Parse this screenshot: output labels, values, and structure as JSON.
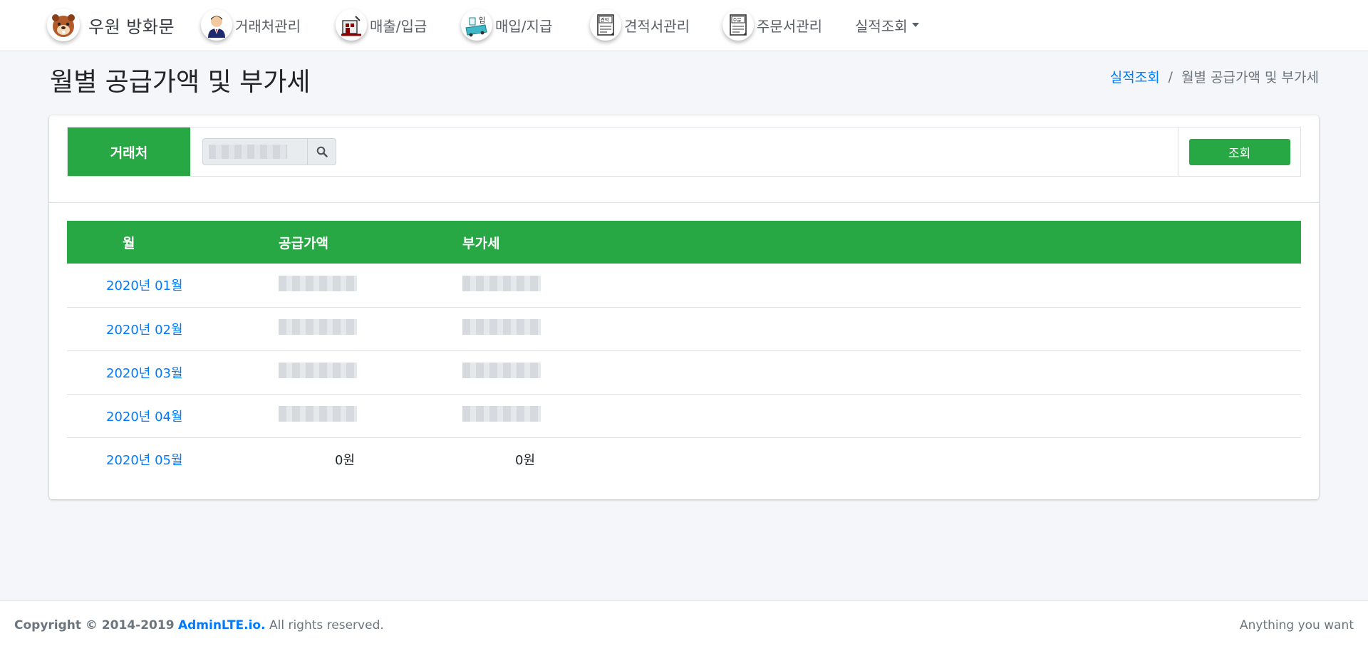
{
  "navbar": {
    "brand_text": "우원 방화문",
    "items": [
      {
        "label": "거래처관리",
        "icon": "client-person-icon"
      },
      {
        "label": "매출/입금",
        "icon": "sales-factory-icon"
      },
      {
        "label": "매입/지급",
        "icon": "purchase-truck-icon"
      },
      {
        "label": "견적서관리",
        "icon": "estimate-document-icon"
      },
      {
        "label": "주문서관리",
        "icon": "order-document-icon"
      }
    ],
    "dropdown_label": "실적조회",
    "icon_stamp_estimate": "견적",
    "icon_stamp_order": "주문",
    "icon_stamp_purchase": "입"
  },
  "header": {
    "title": "월별 공급가액 및 부가세",
    "breadcrumb": {
      "parent": "실적조회",
      "separator": "/",
      "current": "월별 공급가액 및 부가세"
    }
  },
  "search": {
    "label": "거래처",
    "input_value": "",
    "query_button": "조회"
  },
  "table": {
    "columns": [
      "월",
      "공급가액",
      "부가세"
    ],
    "rows": [
      {
        "month": "2020년 01월",
        "supply": "",
        "vat": ""
      },
      {
        "month": "2020년 02월",
        "supply": "",
        "vat": ""
      },
      {
        "month": "2020년 03월",
        "supply": "",
        "vat": ""
      },
      {
        "month": "2020년 04월",
        "supply": "",
        "vat": ""
      },
      {
        "month": "2020년 05월",
        "supply": "0원",
        "vat": "0원"
      }
    ]
  },
  "footer": {
    "copyright_prefix": "Copyright © 2014-2019",
    "brand_link": "AdminLTE.io.",
    "rights": "All rights reserved.",
    "tagline": "Anything you want"
  },
  "colors": {
    "primary_green": "#28a745",
    "link_blue": "#007bff",
    "background": "#f4f6f9"
  }
}
